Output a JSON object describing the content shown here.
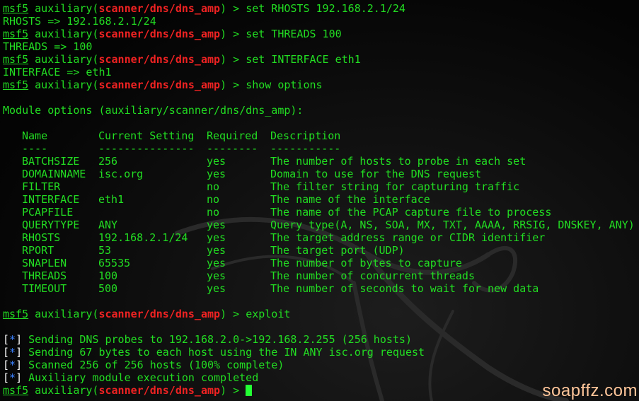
{
  "prompt": {
    "msf": "msf5",
    "module_prefix": " auxiliary(",
    "module_path": "scanner/dns/dns_amp",
    "module_suffix": ") > "
  },
  "session": [
    {
      "type": "cmd",
      "text": "set RHOSTS 192.168.2.1/24"
    },
    {
      "type": "out",
      "text": "RHOSTS => 192.168.2.1/24"
    },
    {
      "type": "cmd",
      "text": "set THREADS 100"
    },
    {
      "type": "out",
      "text": "THREADS => 100"
    },
    {
      "type": "cmd",
      "text": "set INTERFACE eth1"
    },
    {
      "type": "out",
      "text": "INTERFACE => eth1"
    },
    {
      "type": "cmd",
      "text": "show options"
    },
    {
      "type": "blank",
      "text": ""
    },
    {
      "type": "out",
      "text": "Module options (auxiliary/scanner/dns/dns_amp):"
    },
    {
      "type": "blank",
      "text": ""
    }
  ],
  "options_table": {
    "headers": [
      "Name",
      "Current Setting",
      "Required",
      "Description"
    ],
    "dividers": [
      "----",
      "---------------",
      "--------",
      "-----------"
    ],
    "rows": [
      [
        "BATCHSIZE",
        "256",
        "yes",
        "The number of hosts to probe in each set"
      ],
      [
        "DOMAINNAME",
        "isc.org",
        "yes",
        "Domain to use for the DNS request"
      ],
      [
        "FILTER",
        "",
        "no",
        "The filter string for capturing traffic"
      ],
      [
        "INTERFACE",
        "eth1",
        "no",
        "The name of the interface"
      ],
      [
        "PCAPFILE",
        "",
        "no",
        "The name of the PCAP capture file to process"
      ],
      [
        "QUERYTYPE",
        "ANY",
        "yes",
        "Query type(A, NS, SOA, MX, TXT, AAAA, RRSIG, DNSKEY, ANY)"
      ],
      [
        "RHOSTS",
        "192.168.2.1/24",
        "yes",
        "The target address range or CIDR identifier"
      ],
      [
        "RPORT",
        "53",
        "yes",
        "The target port (UDP)"
      ],
      [
        "SNAPLEN",
        "65535",
        "yes",
        "The number of bytes to capture"
      ],
      [
        "THREADS",
        "100",
        "yes",
        "The number of concurrent threads"
      ],
      [
        "TIMEOUT",
        "500",
        "yes",
        "The number of seconds to wait for new data"
      ]
    ]
  },
  "after": [
    {
      "type": "blank",
      "text": ""
    },
    {
      "type": "cmd",
      "text": "exploit"
    },
    {
      "type": "blank",
      "text": ""
    },
    {
      "type": "status",
      "text": "Sending DNS probes to 192.168.2.0->192.168.2.255 (256 hosts)"
    },
    {
      "type": "status",
      "text": "Sending 67 bytes to each host using the IN ANY isc.org request"
    },
    {
      "type": "status",
      "text": "Scanned 256 of 256 hosts (100% complete)"
    },
    {
      "type": "status",
      "text": "Auxiliary module execution completed"
    }
  ],
  "status_tag": {
    "open": "[",
    "star": "*",
    "close": "]"
  },
  "watermark": "soapffz.com",
  "colors": {
    "text": "#22dd22",
    "module_path": "#ee2222",
    "status_star": "#3b82ff",
    "cursor": "#22ff33",
    "background": "#000000",
    "watermark": "#ffc69a"
  }
}
